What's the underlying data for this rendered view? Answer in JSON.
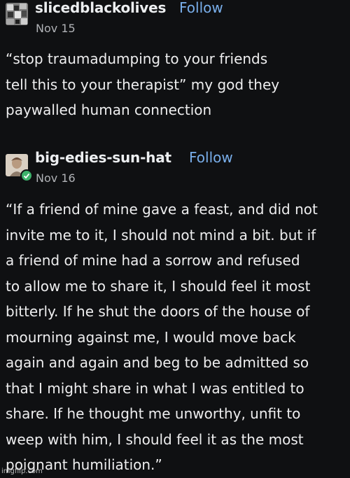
{
  "posts": [
    {
      "username": "slicedblackolives",
      "follow_label": "Follow",
      "date": "Nov 15",
      "lines": [
        "“stop traumadumping to your friends",
        "tell this to your therapist” my god they",
        "paywalled human connection"
      ]
    },
    {
      "username": "big-edies-sun-hat",
      "follow_label": "Follow",
      "date": "Nov 16",
      "lines": [
        "“If a friend of mine gave a feast, and did not",
        "invite me to it, I should not mind a bit. but if",
        "a friend of mine had a sorrow and refused",
        "to allow me to share it, I should feel it most",
        "bitterly. If he shut the doors of the house of",
        "mourning against me, I would move back",
        "again and again and beg to be admitted so",
        "that I might share in what I was entitled to",
        "share. If he thought me unworthy, unfit to",
        "weep with him, I should feel it as the most",
        "poignant humiliation.”"
      ]
    }
  ],
  "watermark": "imgflip.com",
  "colors": {
    "background": "#0f1012",
    "follow": "#79aeea",
    "badge": "#3db36b"
  }
}
